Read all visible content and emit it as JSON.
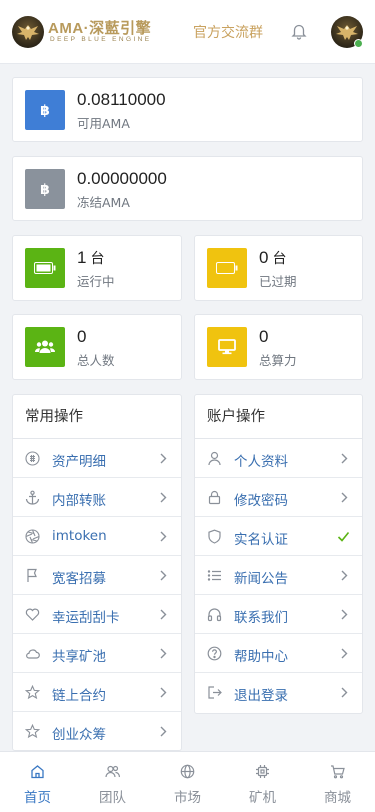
{
  "header": {
    "logo_title": "AMA·深藍引擎",
    "logo_subtitle": "DEEP BLUE ENGINE",
    "group_link": "官方交流群"
  },
  "balances": [
    {
      "value": "0.08110000",
      "label": "可用AMA",
      "icon": "bitcoin-icon",
      "color": "#3f7ed6"
    },
    {
      "value": "0.00000000",
      "label": "冻结AMA",
      "icon": "bitcoin-icon",
      "color": "#8a929c"
    }
  ],
  "stats": [
    {
      "value": "1",
      "unit": "台",
      "label": "运行中",
      "icon": "battery-full-icon",
      "color": "#5bb414"
    },
    {
      "value": "0",
      "unit": "台",
      "label": "已过期",
      "icon": "battery-empty-icon",
      "color": "#f0c30f"
    },
    {
      "value": "0",
      "unit": "",
      "label": "总人数",
      "icon": "users-icon",
      "color": "#5bb414"
    },
    {
      "value": "0",
      "unit": "",
      "label": "总算力",
      "icon": "monitor-icon",
      "color": "#f0c30f"
    }
  ],
  "common_ops": {
    "title": "常用操作",
    "items": [
      {
        "label": "资产明细",
        "icon": "ledger-icon"
      },
      {
        "label": "内部转账",
        "icon": "anchor-icon"
      },
      {
        "label": "imtoken",
        "icon": "aperture-icon"
      },
      {
        "label": "宽客招募",
        "icon": "flag-icon"
      },
      {
        "label": "幸运刮刮卡",
        "icon": "heart-icon"
      },
      {
        "label": "共享矿池",
        "icon": "cloud-icon"
      },
      {
        "label": "链上合约",
        "icon": "star-icon"
      },
      {
        "label": "创业众筹",
        "icon": "star-icon"
      }
    ]
  },
  "account_ops": {
    "title": "账户操作",
    "items": [
      {
        "label": "个人资料",
        "icon": "user-icon"
      },
      {
        "label": "修改密码",
        "icon": "lock-icon"
      },
      {
        "label": "实名认证",
        "icon": "shield-icon",
        "verified": true
      },
      {
        "label": "新闻公告",
        "icon": "list-icon"
      },
      {
        "label": "联系我们",
        "icon": "headphones-icon"
      },
      {
        "label": "帮助中心",
        "icon": "help-circle-icon"
      },
      {
        "label": "退出登录",
        "icon": "logout-icon"
      }
    ]
  },
  "tabbar": [
    {
      "label": "首页",
      "icon": "home-icon",
      "active": true
    },
    {
      "label": "团队",
      "icon": "team-icon",
      "active": false
    },
    {
      "label": "市场",
      "icon": "globe-icon",
      "active": false
    },
    {
      "label": "矿机",
      "icon": "chip-icon",
      "active": false
    },
    {
      "label": "商城",
      "icon": "cart-icon",
      "active": false
    }
  ],
  "colors": {
    "link": "#3a6fb0",
    "active_tab": "#3a78c3",
    "verified": "#5bb414",
    "gold": "#c9a25f"
  }
}
